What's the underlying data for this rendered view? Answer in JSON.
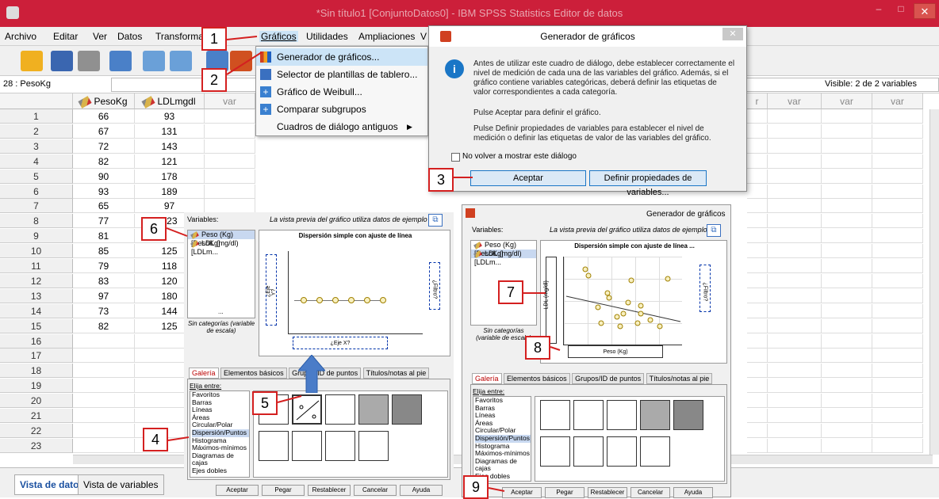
{
  "window": {
    "title": "*Sin título1 [ConjuntoDatos0] - IBM SPSS Statistics Editor de datos",
    "close": "✕"
  },
  "menu": [
    "Archivo",
    "Editar",
    "Ver",
    "Datos",
    "Transformar",
    "Gráficos",
    "Utilidades",
    "Ampliaciones",
    "V"
  ],
  "cellref": {
    "ref": "28 : PesoKg",
    "visible": "Visible: 2 de 2 variables"
  },
  "grid": {
    "columns": [
      "PesoKg",
      "LDLmgdl",
      "var",
      "var",
      "var",
      "var",
      "var"
    ],
    "rows": [
      "1",
      "2",
      "3",
      "4",
      "5",
      "6",
      "7",
      "8",
      "9",
      "10",
      "11",
      "12",
      "13",
      "14",
      "15",
      "16",
      "17",
      "18",
      "19",
      "20",
      "21",
      "22",
      "23"
    ],
    "peso": [
      "66",
      "67",
      "72",
      "82",
      "90",
      "93",
      "65",
      "77",
      "81",
      "85",
      "79",
      "83",
      "97",
      "73",
      "82"
    ],
    "ldl": [
      "93",
      "131",
      "143",
      "121",
      "178",
      "189",
      "97",
      "123",
      "",
      "125",
      "118",
      "120",
      "180",
      "144",
      "125"
    ]
  },
  "tabs": {
    "data": "Vista de datos",
    "vars": "Vista de variables"
  },
  "dropdown": {
    "items": [
      "Generador de gráficos...",
      "Selector de plantillas de tablero...",
      "Gráfico de Weibull...",
      "Comparar subgrupos",
      "Cuadros de diálogo antiguos"
    ]
  },
  "dialog": {
    "title": "Generador de gráficos",
    "close": "✕",
    "text1": "Antes de utilizar este cuadro de diálogo, debe establecer correctamente el nivel de medición de cada una de las variables del gráfico. Además, si el gráfico contiene variables categóricas, deberá definir las etiquetas de valor correspondientes a cada categoría.",
    "text2": "Pulse Aceptar para definir el gráfico.",
    "text3": "Pulse Definir propiedades de variables para establecer el nivel de medición o definir las etiquetas de valor de las variables del gráfico.",
    "checkbox": "No volver a mostrar este diálogo",
    "ok": "Aceptar",
    "define": "Definir propiedades de variables..."
  },
  "builder": {
    "variables_label": "Variables:",
    "preview_note": "La vista previa del gráfico utiliza datos de ejemplo",
    "var1": "Peso (Kg) [PesoKg]",
    "var2": "LDL (mg/dl) [LDLm...",
    "no_categories": "Sin categorías (variable de escala)",
    "chart_title": "Dispersión simple con ajuste de línea",
    "chart_title_right": "Dispersión simple con ajuste de línea ...",
    "y_axis": "¿Eje Y?",
    "x_axis": "¿Eje X?",
    "filter": "¿Filtro?",
    "y_assigned": "LDL (mg/dl)",
    "x_assigned": "Peso (Kg)",
    "tabs": [
      "Galería",
      "Elementos básicos",
      "Grupos/ID de puntos",
      "Títulos/notas al pie"
    ],
    "choose": "Elija entre:",
    "types": [
      "Favoritos",
      "Barras",
      "Líneas",
      "Áreas",
      "Circular/Polar",
      "Dispersión/Puntos",
      "Histograma",
      "Máximos-mínimos",
      "Diagramas de cajas",
      "Ejes dobles"
    ],
    "buttons": [
      "Aceptar",
      "Pegar",
      "Restablecer",
      "Cancelar",
      "Ayuda"
    ],
    "window_title": "Generador de gráficos",
    "hidden_tabs_left": "Grupos/ID de puntos",
    "ellipsis": "..."
  },
  "callouts": [
    "1",
    "2",
    "3",
    "4",
    "5",
    "6",
    "7",
    "8",
    "9"
  ]
}
